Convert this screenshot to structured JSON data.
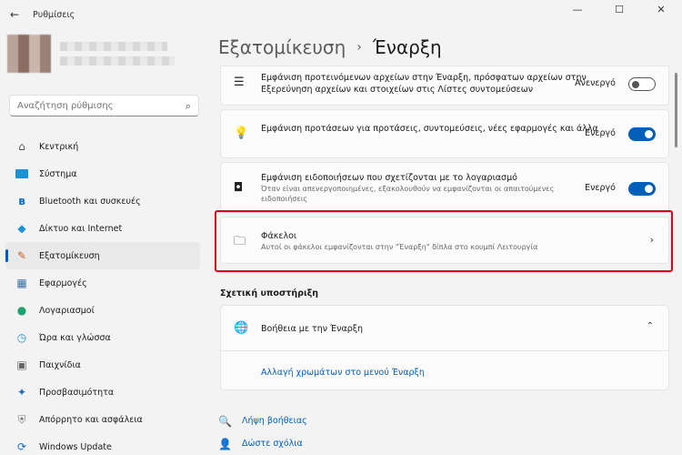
{
  "window": {
    "title": "Ρυθμίσεις",
    "controls": [
      "—",
      "☐",
      "✕"
    ]
  },
  "search": {
    "placeholder": "Αναζήτηση ρύθμισης"
  },
  "sidebar": {
    "items": [
      {
        "label": "Κεντρική",
        "icon": "home-icon",
        "glyph": "🏠"
      },
      {
        "label": "Σύστημα",
        "icon": "system-icon",
        "glyph": "▬"
      },
      {
        "label": "Bluetooth και συσκευές",
        "icon": "bluetooth-icon",
        "glyph": "✱"
      },
      {
        "label": "Δίκτυο και Internet",
        "icon": "network-icon",
        "glyph": "◆"
      },
      {
        "label": "Εξατομίκευση",
        "icon": "personalization-icon",
        "glyph": "✎",
        "active": true
      },
      {
        "label": "Εφαρμογές",
        "icon": "apps-icon",
        "glyph": "▦"
      },
      {
        "label": "Λογαριασμοί",
        "icon": "accounts-icon",
        "glyph": "●"
      },
      {
        "label": "Ώρα και γλώσσα",
        "icon": "time-language-icon",
        "glyph": "◷"
      },
      {
        "label": "Παιχνίδια",
        "icon": "gaming-icon",
        "glyph": "▣"
      },
      {
        "label": "Προσβασιμότητα",
        "icon": "accessibility-icon",
        "glyph": "✦"
      },
      {
        "label": "Απόρρητο και ασφάλεια",
        "icon": "shield-icon",
        "glyph": "⛨"
      },
      {
        "label": "Windows Update",
        "icon": "windows-update-icon",
        "glyph": "⟳"
      }
    ]
  },
  "header": {
    "crumb": "Εξατομίκευση",
    "separator": "›",
    "current": "Έναρξη"
  },
  "settings": {
    "recent": {
      "text": "Εμφάνιση προτεινόμενων αρχείων στην Έναρξη, πρόσφατων αρχείων στην Εξερεύνηση αρχείων και στοιχείων στις Λίστες συντομεύσεων",
      "state": "Ανενεργό",
      "on": false
    },
    "recommendations": {
      "text": "Εμφάνιση προτάσεων για προτάσεις, συντομεύσεις, νέες εφαρμογές και άλλα",
      "state": "Ενεργό",
      "on": true
    },
    "account_notifications": {
      "text": "Εμφάνιση ειδοποιήσεων που σχετίζονται με το λογαριασμό",
      "sub": "Όταν είναι απενεργοποιημένες, εξακολουθούν να εμφανίζονται οι απαιτούμενες ειδοποιήσεις",
      "state": "Ενεργό",
      "on": true
    },
    "folders": {
      "title": "Φάκελοι",
      "sub": "Αυτοί οι φάκελοι εμφανίζονται στην \"Έναρξη\" δίπλα στο κουμπί Λειτουργία"
    }
  },
  "related": {
    "title": "Σχετική υποστήριξη",
    "help_title": "Βοήθεια με την Έναρξη",
    "help_link": "Αλλαγή χρωμάτων στο μενού Έναρξη"
  },
  "footer": {
    "get_help": "Λήψη βοήθειας",
    "feedback": "Δώστε σχόλια"
  },
  "colors": {
    "accent": "#005fb8",
    "highlight": "#e3001b"
  }
}
